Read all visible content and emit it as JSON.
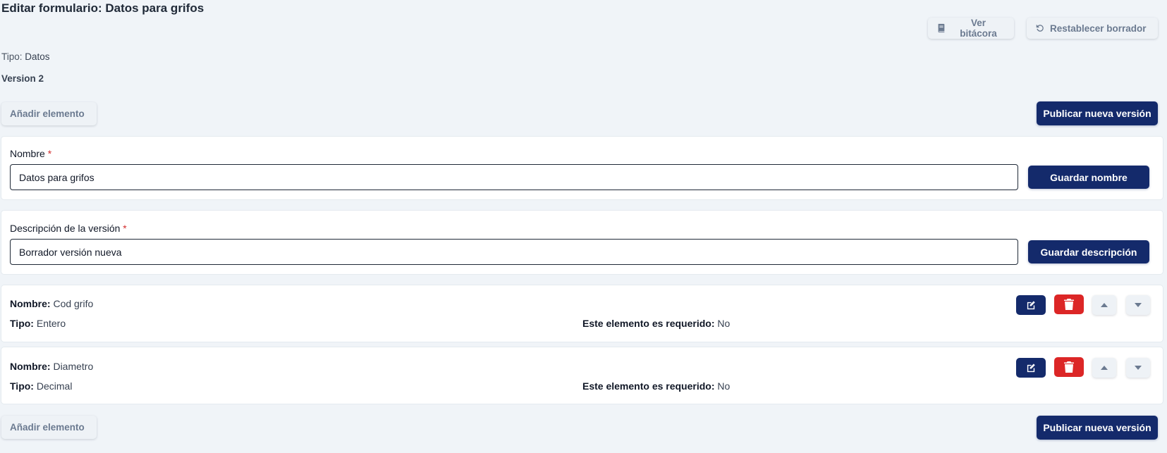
{
  "page_title": "Editar formulario: Datos para grifos",
  "toolbar": {
    "log_label": "Ver bitácora",
    "reset_label": "Restablecer borrador"
  },
  "meta": {
    "type_label": "Tipo:",
    "type_value": "Datos",
    "version": "Version 2"
  },
  "actions": {
    "add_element_label": "Añadir elemento",
    "publish_label": "Publicar nueva versión"
  },
  "name_card": {
    "label": "Nombre",
    "required_mark": "*",
    "value": "Datos para grifos",
    "save_label": "Guardar nombre"
  },
  "description_card": {
    "label": "Descripción de la versión",
    "required_mark": "*",
    "value": "Borrador versión nueva",
    "save_label": "Guardar descripción"
  },
  "element_labels": {
    "name": "Nombre:",
    "type": "Tipo:",
    "required": "Este elemento es requerido:"
  },
  "elements": [
    {
      "name": "Cod grifo",
      "type": "Entero",
      "required": "No"
    },
    {
      "name": "Diametro",
      "type": "Decimal",
      "required": "No"
    }
  ],
  "icons": {
    "log": "book-icon",
    "reset": "undo-icon",
    "edit": "edit-icon",
    "delete": "trash-icon",
    "up": "caret-up-icon",
    "down": "caret-down-icon"
  },
  "colors": {
    "primary": "#142a6b",
    "danger": "#dc2626",
    "background": "#f0f4f8",
    "required": "#d32f2f"
  }
}
